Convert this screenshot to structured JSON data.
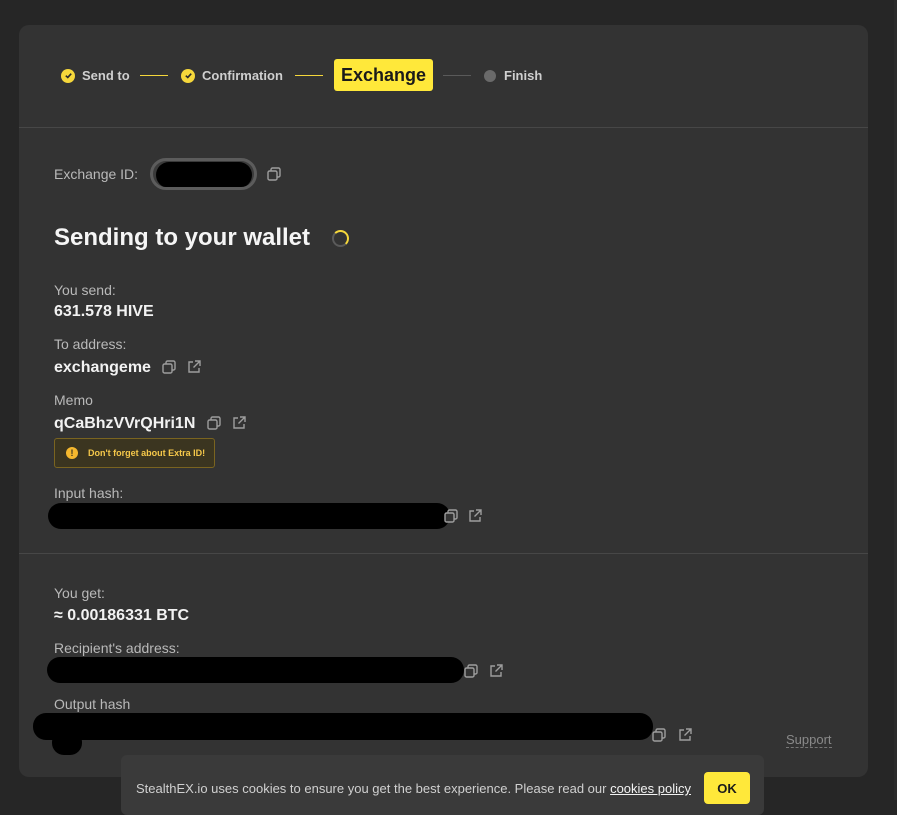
{
  "stepper": {
    "steps": [
      {
        "label": "Send to",
        "state": "done"
      },
      {
        "label": "Confirmation",
        "state": "done"
      },
      {
        "label": "Exchange",
        "state": "active"
      },
      {
        "label": "Finish",
        "state": "pending"
      }
    ]
  },
  "exchange": {
    "id_label": "Exchange ID:",
    "status_title": "Sending to your wallet",
    "you_send_label": "You send:",
    "you_send_value": "631.578 HIVE",
    "to_address_label": "To address:",
    "to_address_value": "exchangeme",
    "memo_label": "Memo",
    "memo_value": "qCaBhzVVrQHri1N",
    "extra_id_warning": "Don't forget about Extra ID!",
    "input_hash_label": "Input hash:",
    "you_get_label": "You get:",
    "you_get_value": "≈ 0.00186331 BTC",
    "recipient_label": "Recipient's address:",
    "output_hash_label": "Output hash"
  },
  "support_label": "Support",
  "cookie": {
    "text": "StealthEX.io uses cookies to ensure you get the best experience. Please read our ",
    "link": "cookies policy",
    "ok": "OK"
  },
  "colors": {
    "accent": "#ffe83a",
    "card": "#333333",
    "background": "#262626",
    "warning": "#f5b82e"
  }
}
